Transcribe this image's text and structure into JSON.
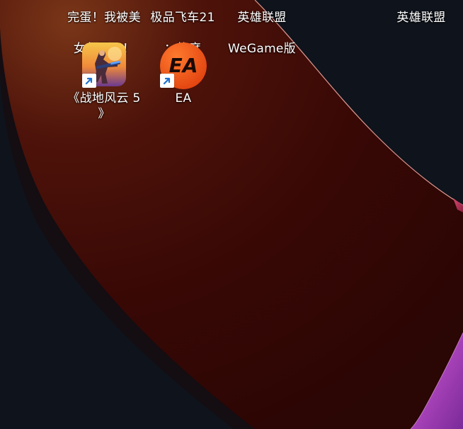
{
  "desktop": {
    "top_labels": [
      {
        "line1": "完蛋！我被美",
        "line2": "女包围了！"
      },
      {
        "line1": "极品飞车21",
        "line2": "：热度"
      },
      {
        "line1": "英雄联盟",
        "line2": "WeGame版"
      },
      {
        "line1": "英雄联盟",
        "line2": ""
      }
    ],
    "icons": [
      {
        "name": "battlefield-5",
        "label": "《战地风云 5\n》",
        "icon": "soldier-game-icon"
      },
      {
        "name": "ea",
        "label": "EA",
        "icon": "ea-logo-icon",
        "logo_text": "EA"
      }
    ]
  },
  "colors": {
    "background": "#0f131b",
    "wave_dark": "#3a0a05",
    "wave_rim": "#f3a8a0",
    "ea_orange": "#f25a1e",
    "magenta": "#c23ccf"
  }
}
